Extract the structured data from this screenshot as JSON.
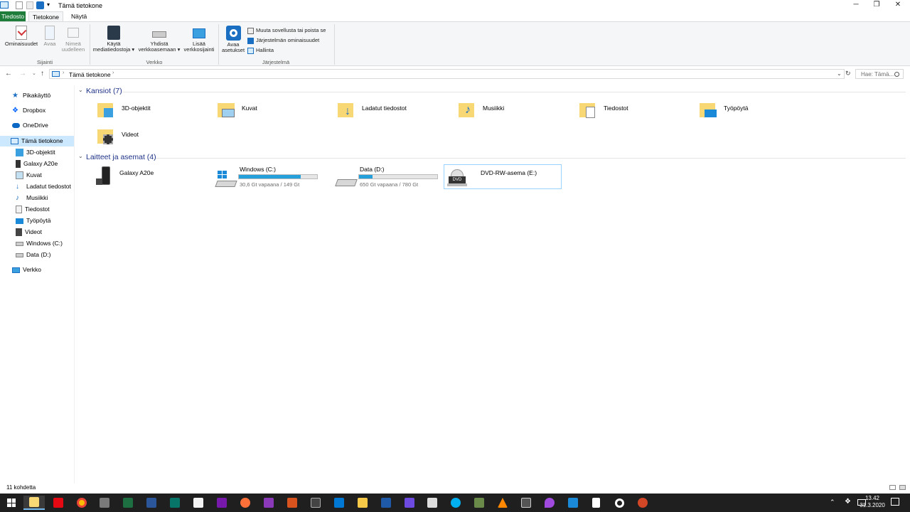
{
  "window": {
    "title": "Tämä tietokone"
  },
  "tabs": [
    "Tiedosto",
    "Tietokone",
    "Näytä"
  ],
  "ribbon": {
    "location": {
      "properties": "Ominaisuudet",
      "open": "Avaa",
      "rename_1": "Nimeä",
      "rename_2": "uudelleen",
      "group": "Sijainti"
    },
    "network": {
      "media_1": "Käytä",
      "media_2": "mediatiedostoja",
      "map_1": "Yhdistä",
      "map_2": "verkkoasemaan",
      "add_1": "Lisää",
      "add_2": "verkkosijainti",
      "group": "Verkko"
    },
    "system": {
      "settings_1": "Avaa",
      "settings_2": "asetukset",
      "uninstall": "Muuta sovellusta tai poista se",
      "sysprops": "Järjestelmän ominaisuudet",
      "manage": "Hallinta",
      "group": "Järjestelmä"
    }
  },
  "address": {
    "path": "Tämä tietokone",
    "search_placeholder": "Hae: Tämä..."
  },
  "nav": {
    "quick": "Pikakäyttö",
    "dropbox": "Dropbox",
    "onedrive": "OneDrive",
    "thispc": "Tämä tietokone",
    "sub": [
      "3D-objektit",
      "Galaxy A20e",
      "Kuvat",
      "Ladatut tiedostot",
      "Musiikki",
      "Tiedostot",
      "Työpöytä",
      "Videot",
      "Windows (C:)",
      "Data (D:)"
    ],
    "network": "Verkko"
  },
  "folders": {
    "header": "Kansiot (7)",
    "items": [
      "3D-objektit",
      "Kuvat",
      "Ladatut tiedostot",
      "Musiikki",
      "Tiedostot",
      "Työpöytä",
      "Videot"
    ]
  },
  "devices": {
    "header": "Laitteet ja asemat (4)",
    "phone": "Galaxy A20e",
    "c": {
      "name": "Windows (C:)",
      "free": "30,6 Gt vapaana / 149 Gt",
      "used_fraction": 0.79
    },
    "d": {
      "name": "Data (D:)",
      "free": "650 Gt vapaana / 780 Gt",
      "used_fraction": 0.17
    },
    "dvd": {
      "name": "DVD-RW-asema (E:)",
      "label": "DVD"
    }
  },
  "status": {
    "count": "11 kohdetta"
  },
  "clock": {
    "time": "13.42",
    "date": "31.3.2020"
  },
  "colors": {
    "accent": "#26a0da",
    "file_tab": "#1e7d3a",
    "header": "#1e3287",
    "taskbar": "#1f1f1f"
  }
}
